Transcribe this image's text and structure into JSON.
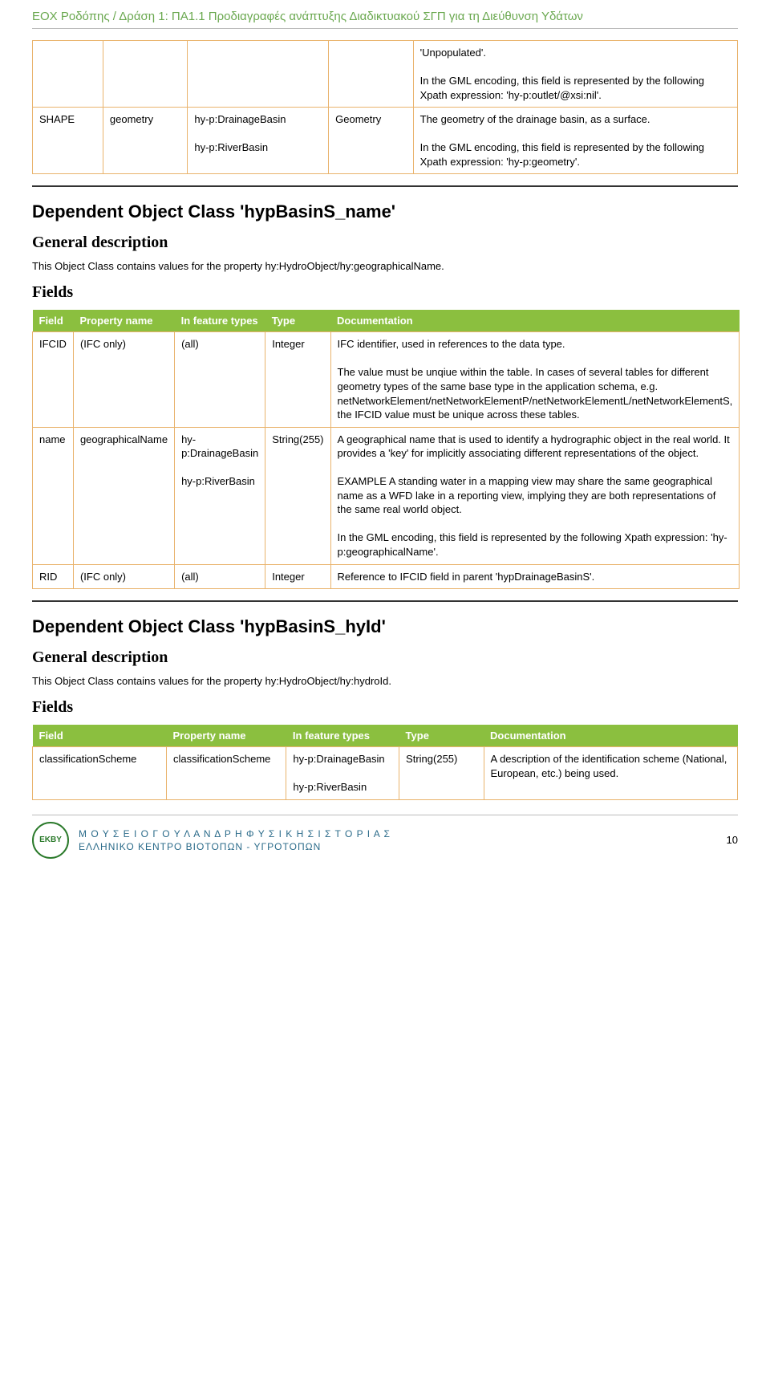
{
  "header": "ΕΟΧ Ροδόπης / Δράση 1: ΠΑ1.1 Προδιαγραφές ανάπτυξης Διαδικτυακού ΣΓΠ για τη Διεύθυνση Υδάτων",
  "pageNumber": "10",
  "footer": {
    "logoText": "EKBY",
    "line1": "Μ Ο Υ Σ Ε Ι Ο   Γ Ο Υ Λ Α Ν Δ Ρ Η   Φ Υ Σ Ι Κ Η Σ   Ι Σ Τ Ο Ρ Ι Α Σ",
    "line2": "ΕΛΛΗΝΙΚΟ ΚΕΝΤΡΟ ΒΙΟΤΟΠΩΝ - ΥΓΡΟΤΟΠΩΝ"
  },
  "table1": {
    "rows": [
      {
        "c0": "",
        "c1": "",
        "c2": "",
        "c3": "",
        "c4": "'Unpopulated'.\n\nIn the GML encoding, this field is represented by the following Xpath expression: 'hy-p:outlet/@xsi:nil'."
      },
      {
        "c0": "SHAPE",
        "c1": "geometry",
        "c2": "hy-p:DrainageBasin\n\nhy-p:RiverBasin",
        "c3": "Geometry",
        "c4": "The geometry of the drainage basin, as a surface.\n\nIn the GML encoding, this field is represented by the following Xpath expression: 'hy-p:geometry'."
      }
    ]
  },
  "section1": {
    "title": "Dependent Object Class 'hypBasinS_name'",
    "subGeneral": "General description",
    "descText": "This Object Class contains values for the property hy:HydroObject/hy:geographicalName.",
    "subFields": "Fields",
    "headers": {
      "h0": "Field",
      "h1": "Property name",
      "h2": "In feature types",
      "h3": "Type",
      "h4": "Documentation"
    },
    "rows": [
      {
        "c0": "IFCID",
        "c1": "(IFC only)",
        "c2": "(all)",
        "c3": "Integer",
        "c4": "IFC identifier, used in references to the data type.\n\nThe value must be unqiue within the table. In cases of several tables for different geometry types of the same base type in the application schema, e.g. netNetworkElement/netNetworkElementP/netNetworkElementL/netNetworkElementS, the IFCID value must be unique across these tables."
      },
      {
        "c0": "name",
        "c1": "geographicalName",
        "c2": "hy-p:DrainageBasin\n\nhy-p:RiverBasin",
        "c3": "String(255)",
        "c4": "A geographical name that is used to identify a hydrographic object in the real world. It provides a 'key' for implicitly associating different representations of the object.\n\nEXAMPLE A standing water in a mapping view may share the same geographical name as a WFD lake in a reporting view, implying they are both representations of the same real world object.\n\nIn the GML encoding, this field is represented by the following Xpath expression: 'hy-p:geographicalName'."
      },
      {
        "c0": "RID",
        "c1": "(IFC only)",
        "c2": "(all)",
        "c3": "Integer",
        "c4": "Reference to IFCID field in parent 'hypDrainageBasinS'."
      }
    ]
  },
  "section2": {
    "title": "Dependent Object Class 'hypBasinS_hyId'",
    "subGeneral": "General description",
    "descText": "This Object Class contains values for the property hy:HydroObject/hy:hydroId.",
    "subFields": "Fields",
    "headers": {
      "h0": "Field",
      "h1": "Property name",
      "h2": "In feature types",
      "h3": "Type",
      "h4": "Documentation"
    },
    "rows": [
      {
        "c0": "classificationScheme",
        "c1": "classificationScheme",
        "c2": "hy-p:DrainageBasin\n\nhy-p:RiverBasin",
        "c3": "String(255)",
        "c4": "A description of the identification scheme (National, European, etc.) being used."
      }
    ]
  }
}
